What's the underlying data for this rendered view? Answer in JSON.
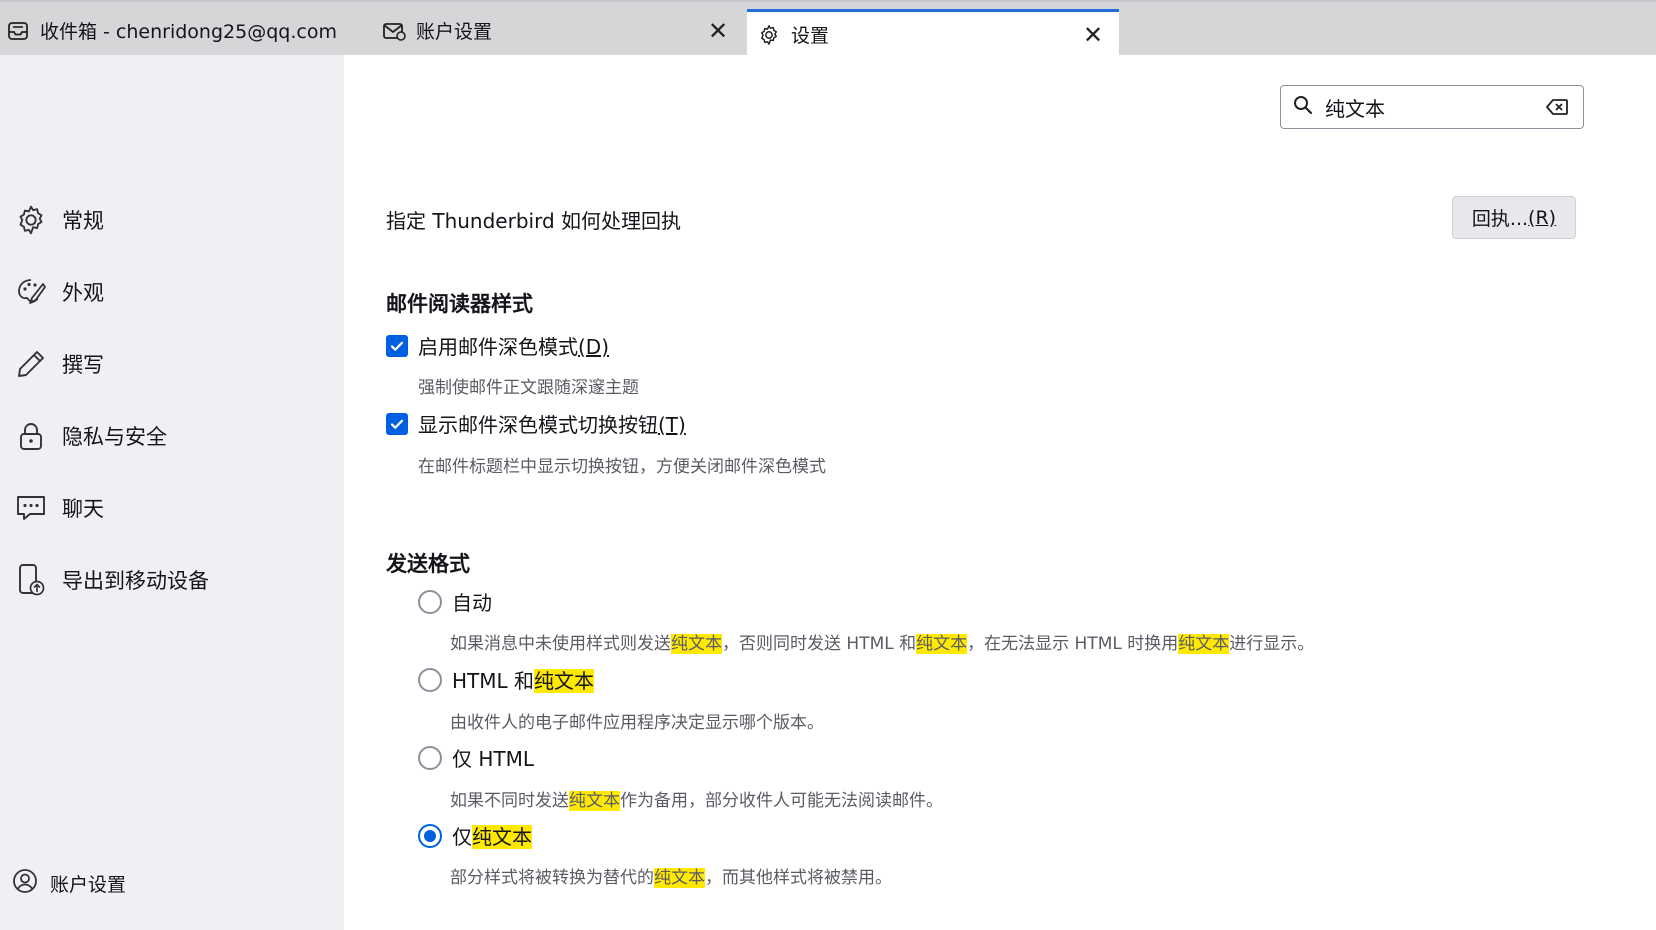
{
  "tabs": [
    {
      "label": "收件箱 - chenridong25@qq.com",
      "icon": "inbox-icon"
    },
    {
      "label": "账户设置",
      "icon": "mail-settings-icon",
      "closable": true
    },
    {
      "label": "设置",
      "icon": "gear-icon",
      "closable": true,
      "active": true
    }
  ],
  "tab_close_glyph": "✕",
  "sidebar": {
    "items": [
      {
        "label": "常规",
        "icon": "gear-icon"
      },
      {
        "label": "外观",
        "icon": "palette-icon"
      },
      {
        "label": "撰写",
        "icon": "pencil-icon"
      },
      {
        "label": "隐私与安全",
        "icon": "lock-icon"
      },
      {
        "label": "聊天",
        "icon": "chat-icon"
      },
      {
        "label": "导出到移动设备",
        "icon": "mobile-export-icon"
      }
    ],
    "account_settings": {
      "label": "账户设置",
      "icon": "account-icon"
    }
  },
  "search": {
    "value": "纯文本"
  },
  "receipts": {
    "text": "指定 Thunderbird 如何处理回执",
    "button_label": "回执...",
    "button_accel": "(R)"
  },
  "reader_style": {
    "title": "邮件阅读器样式",
    "options": [
      {
        "label": "启用邮件深色模式",
        "accel": "(D)",
        "checked": true,
        "desc": "强制使邮件正文跟随深邃主题"
      },
      {
        "label": "显示邮件深色模式切换按钮",
        "accel": "(T)",
        "checked": true,
        "desc": "在邮件标题栏中显示切换按钮，方便关闭邮件深色模式"
      }
    ]
  },
  "send_format": {
    "title": "发送格式",
    "highlight": "纯文本",
    "options": [
      {
        "label_parts": [
          "自动"
        ],
        "desc_parts": [
          "如果消息中未使用样式则发送",
          "纯文本",
          "，否则同时发送 HTML 和",
          "纯文本",
          "，在无法显示 HTML 时换用",
          "纯文本",
          "进行显示。"
        ],
        "selected": false
      },
      {
        "label_parts": [
          "HTML 和",
          "纯文本"
        ],
        "desc_parts": [
          "由收件人的电子邮件应用程序决定显示哪个版本。"
        ],
        "selected": false
      },
      {
        "label_parts": [
          "仅 HTML"
        ],
        "desc_parts": [
          "如果不同时发送",
          "纯文本",
          "作为备用，部分收件人可能无法阅读邮件。"
        ],
        "selected": false
      },
      {
        "label_parts": [
          "仅",
          "纯文本"
        ],
        "desc_parts": [
          "部分样式将被转换为替代的",
          "纯文本",
          "，而其他样式将被禁用。"
        ],
        "selected": true
      }
    ]
  },
  "colors": {
    "accent": "#0061e0",
    "highlight": "#ffe900",
    "sidebar_bg": "#f0f0f4",
    "tabbar_bg": "#d6d6d9"
  }
}
